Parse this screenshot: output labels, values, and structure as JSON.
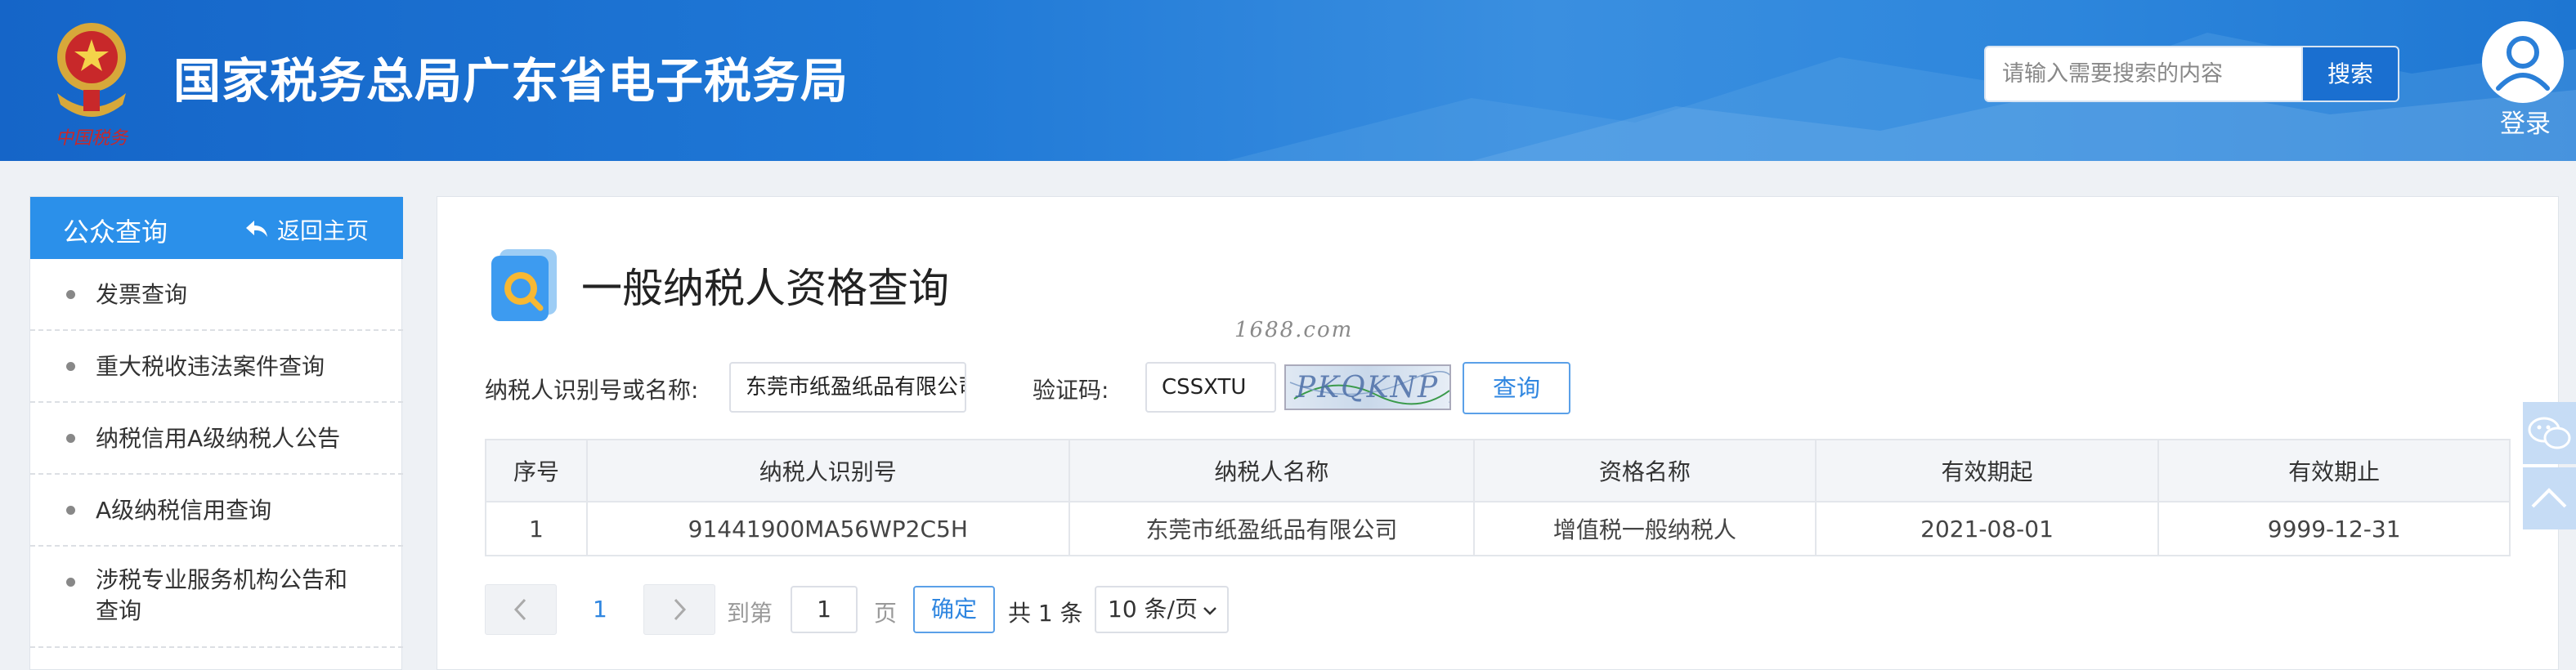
{
  "header": {
    "emblem_caption": "中国税务",
    "site_title": "国家税务总局广东省电子税务局",
    "search_placeholder": "请输入需要搜索的内容",
    "search_button": "搜索",
    "login_label": "登录"
  },
  "sidebar": {
    "title": "公众查询",
    "back_label": "返回主页",
    "items": [
      {
        "label": "发票查询"
      },
      {
        "label": "重大税收违法案件查询"
      },
      {
        "label": "纳税信用A级纳税人公告"
      },
      {
        "label": "A级纳税信用查询"
      },
      {
        "label": "涉税专业服务机构公告和",
        "label2": "查询"
      }
    ]
  },
  "main": {
    "title": "一般纳税人资格查询",
    "watermark": "1688.com",
    "form": {
      "taxpayer_label": "纳税人识别号或名称:",
      "taxpayer_value": "东莞市纸盈纸品有限公司",
      "captcha_label": "验证码:",
      "captcha_input_value": "CSSXTU",
      "captcha_image_text": "PKQKNP",
      "query_button": "查询"
    },
    "table": {
      "headers": [
        "序号",
        "纳税人识别号",
        "纳税人名称",
        "资格名称",
        "有效期起",
        "有效期止"
      ],
      "rows": [
        [
          "1",
          "91441900MA56WP2C5H",
          "东莞市纸盈纸品有限公司",
          "增值税一般纳税人",
          "2021-08-01",
          "9999-12-31"
        ]
      ]
    },
    "pagination": {
      "prev_icon": "chevron-left-icon",
      "current_page": "1",
      "next_icon": "chevron-right-icon",
      "goto_prefix": "到第",
      "goto_value": "1",
      "goto_suffix": "页",
      "confirm_button": "确定",
      "total_text": "共 1 条",
      "page_size": "10 条/页"
    }
  },
  "floating": {
    "wechat_icon": "wechat-icon",
    "top_icon": "chevron-up-icon"
  },
  "colors": {
    "header_blue": "#1f78d6",
    "sidebar_head": "#2b90ea",
    "link_blue": "#2f86e0"
  }
}
